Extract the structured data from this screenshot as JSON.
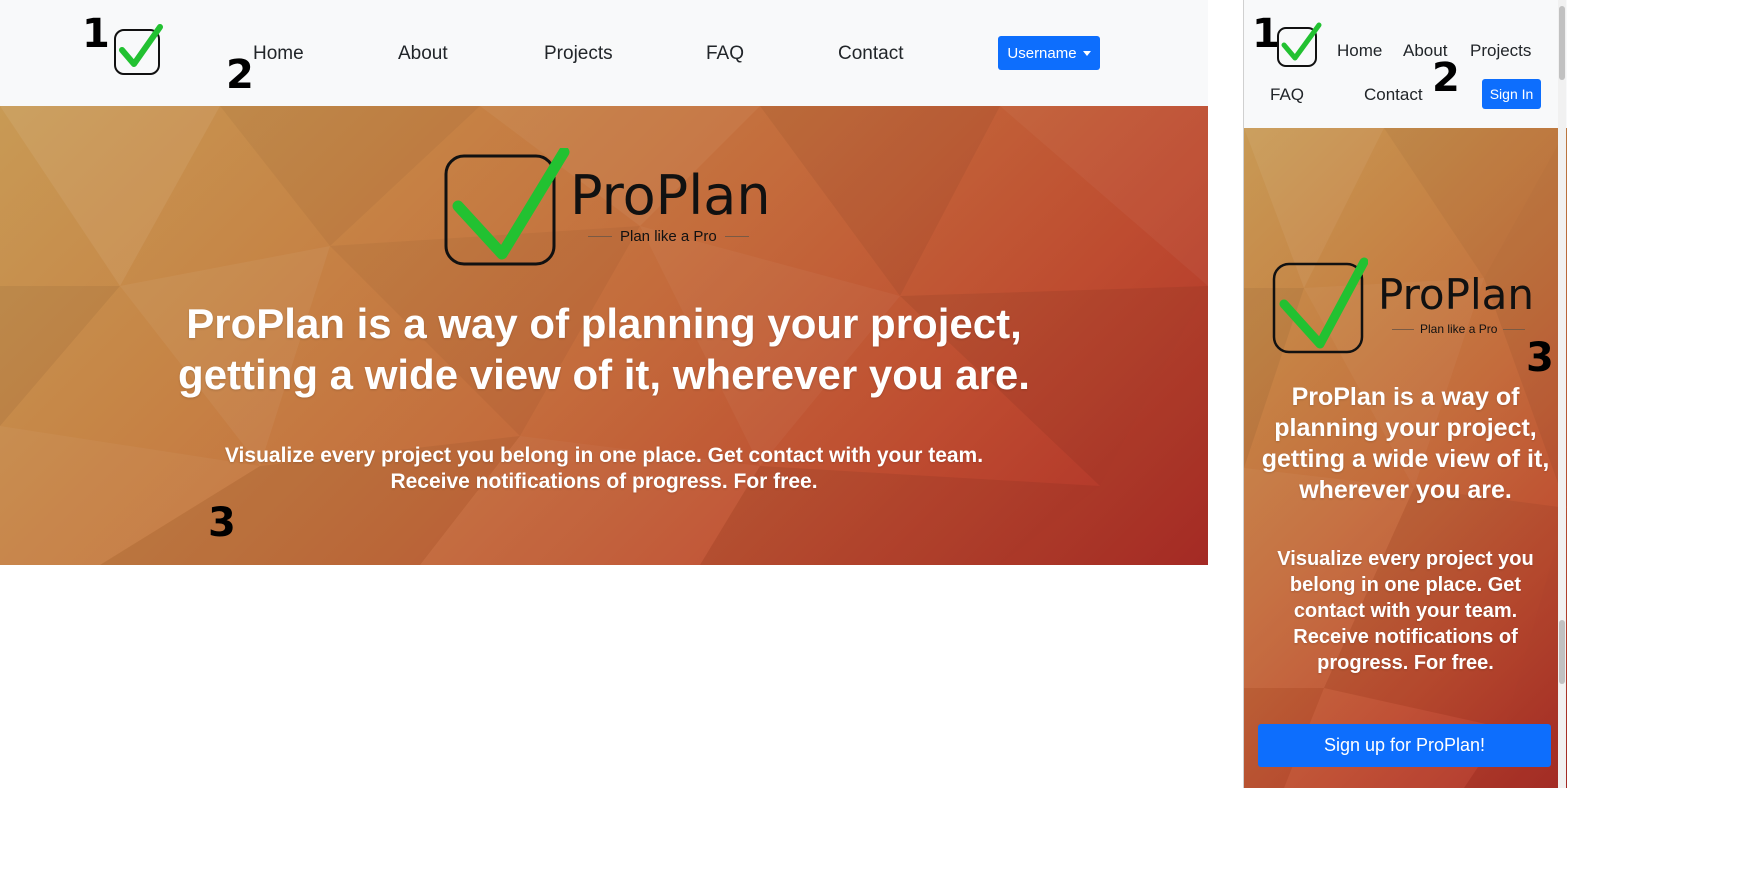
{
  "colors": {
    "navbar_bg": "#f8f9fa",
    "primary_button": "#0d6efd",
    "check_green": "#22c131",
    "hero_text": "#ffffff"
  },
  "desktop": {
    "nav": {
      "home": "Home",
      "about": "About",
      "projects": "Projects",
      "faq": "FAQ",
      "contact": "Contact",
      "user_button": "Username"
    },
    "hero": {
      "brand_name": "ProPlan",
      "brand_tagline": "Plan like a Pro",
      "headline_line1": "ProPlan is a way of planning your project,",
      "headline_line2": "getting a wide view of it, wherever you are.",
      "sub_line1": "Visualize every project you belong in one place. Get contact with your team.",
      "sub_line2": "Receive notifications of progress. For free."
    },
    "markers": {
      "m1": "1",
      "m2": "2",
      "m3": "3"
    }
  },
  "mobile": {
    "nav": {
      "home": "Home",
      "about": "About",
      "projects": "Projects",
      "faq": "FAQ",
      "contact": "Contact",
      "sign_in": "Sign In"
    },
    "hero": {
      "brand_name": "ProPlan",
      "brand_tagline": "Plan like a Pro",
      "headline": "ProPlan is a way of planning your project, getting a wide view of it, wherever you are.",
      "sub": "Visualize every project you belong in one place. Get contact with your team. Receive notifications of progress. For free.",
      "cta": "Sign up for ProPlan!"
    },
    "markers": {
      "m1": "1",
      "m2": "2",
      "m3": "3"
    }
  },
  "icons": {
    "logo": "checkbox-check-icon",
    "dropdown": "caret-down-icon"
  }
}
